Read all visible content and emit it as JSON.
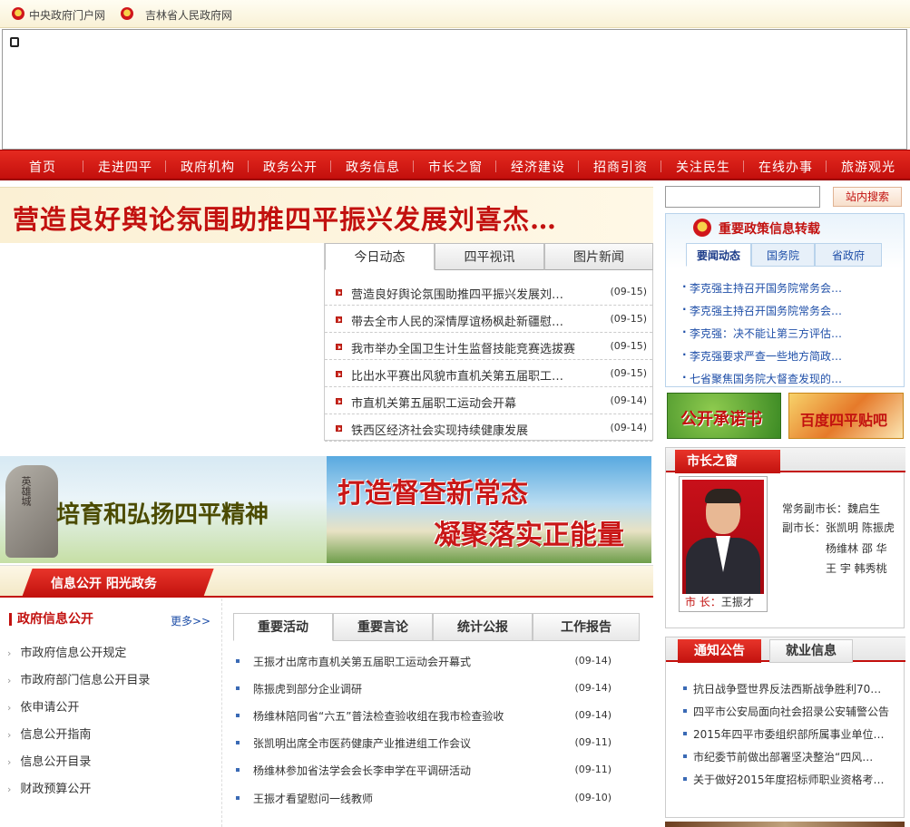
{
  "topbar": {
    "links": [
      "中央政府门户网",
      "吉林省人民政府网"
    ]
  },
  "nav": {
    "items": [
      "首页",
      "走进四平",
      "政府机构",
      "政务公开",
      "政务信息",
      "市长之窗",
      "经济建设",
      "招商引资",
      "关注民生",
      "在线办事",
      "旅游观光"
    ]
  },
  "headline": {
    "text": "营造良好舆论氛围助推四平振兴发展刘喜杰…"
  },
  "news": {
    "tabs": [
      "今日动态",
      "四平视讯",
      "图片新闻"
    ],
    "items": [
      {
        "title": "营造良好舆论氛围助推四平振兴发展刘…",
        "date": "(09-15)"
      },
      {
        "title": "带去全市人民的深情厚谊杨枫赴新疆慰…",
        "date": "(09-15)"
      },
      {
        "title": "我市举办全国卫生计生监督技能竞赛选拔赛",
        "date": "(09-15)"
      },
      {
        "title": "比出水平赛出风貌市直机关第五届职工…",
        "date": "(09-15)"
      },
      {
        "title": "市直机关第五届职工运动会开幕",
        "date": "(09-14)"
      },
      {
        "title": "铁西区经济社会实现持续健康发展",
        "date": "(09-14)"
      }
    ]
  },
  "promos": {
    "left_text": "培育和弘扬四平精神",
    "left_rock_text": "英雄城",
    "right_line1": "打造督查新常态",
    "right_line2": "凝聚落实正能量"
  },
  "infobar": {
    "label": "信息公开  阳光政务"
  },
  "gov_info": {
    "title": "政府信息公开",
    "more": "更多>>",
    "items": [
      "市政府信息公开规定",
      "市政府部门信息公开目录",
      "依申请公开",
      "信息公开指南",
      "信息公开目录",
      "财政预算公开"
    ]
  },
  "activities": {
    "tabs": [
      "重要活动",
      "重要言论",
      "统计公报",
      "工作报告"
    ],
    "items": [
      {
        "title": "王振才出席市直机关第五届职工运动会开幕式",
        "date": "(09-14)"
      },
      {
        "title": "陈振虎到部分企业调研",
        "date": "(09-14)"
      },
      {
        "title": "杨维林陪同省“六五”普法检查验收组在我市检查验收",
        "date": "(09-14)"
      },
      {
        "title": "张凯明出席全市医药健康产业推进组工作会议",
        "date": "(09-11)"
      },
      {
        "title": "杨维林参加省法学会会长李申学在平调研活动",
        "date": "(09-11)"
      },
      {
        "title": "王振才看望慰问一线教师",
        "date": "(09-10)"
      }
    ]
  },
  "search": {
    "placeholder": "",
    "button": "站内搜索"
  },
  "policy": {
    "title": "重要政策信息转载",
    "tabs": [
      "要闻动态",
      "国务院",
      "省政府"
    ],
    "items": [
      "李克强主持召开国务院常务会…",
      "李克强主持召开国务院常务会…",
      "李克强：决不能让第三方评估…",
      "李克强要求严查一些地方简政…",
      "七省聚焦国务院大督查发现的…"
    ]
  },
  "buttons": {
    "promise": "公开承诺书",
    "tieba": "百度四平贴吧"
  },
  "mayor": {
    "tab": "市长之窗",
    "caption_label": "市  长：",
    "caption_name": "王振才",
    "exec_label": "常务副市长：",
    "exec_name": "魏启生",
    "vice_label": "副市长：",
    "vice_line1": "张凯明  陈振虎",
    "vice_line2": "杨维林  邵  华",
    "vice_line3": "王  宇  韩秀桃"
  },
  "notices": {
    "tabs": [
      "通知公告",
      "就业信息"
    ],
    "items": [
      "抗日战争暨世界反法西斯战争胜利70…",
      "四平市公安局面向社会招录公安辅警公告",
      "2015年四平市委组织部所属事业单位…",
      "市纪委节前做出部署坚决整治“四风…",
      "关于做好2015年度招标师职业资格考…"
    ]
  },
  "colors": {
    "brand_red": "#c2110f",
    "link_blue": "#1f4fa8"
  }
}
